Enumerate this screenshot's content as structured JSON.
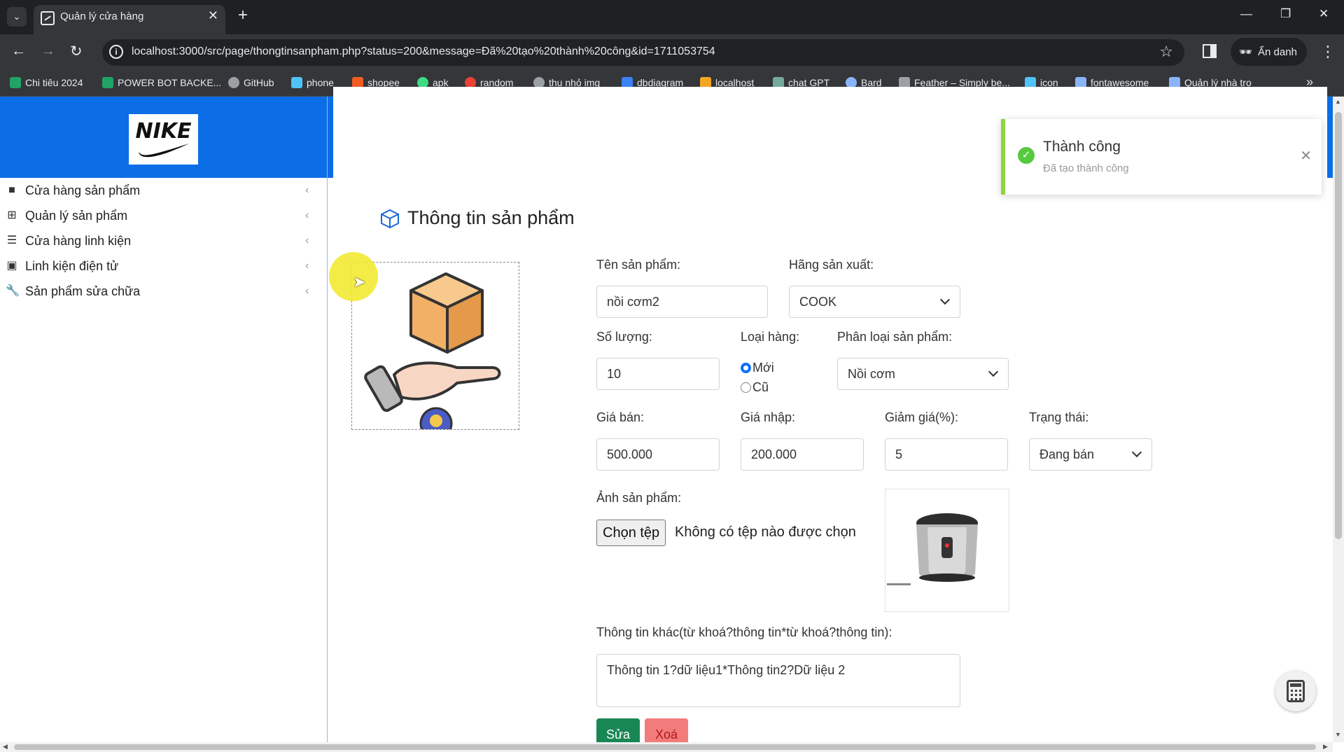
{
  "browser": {
    "tab_title": "Quản lý cửa hàng",
    "url": "localhost:3000/src/page/thongtinsanpham.php?status=200&message=Đã%20tạo%20thành%20công&id=1711053754",
    "profile_label": "Ẩn danh",
    "bookmarks": [
      {
        "label": "Chi tiêu 2024",
        "color": "#21a366"
      },
      {
        "label": "POWER BOT BACKE...",
        "color": "#21a366"
      },
      {
        "label": "GitHub",
        "color": "#9aa0a6"
      },
      {
        "label": "phone",
        "color": "#4fc3f7"
      },
      {
        "label": "shopee",
        "color": "#f05d23"
      },
      {
        "label": "apk",
        "color": "#3ddc84"
      },
      {
        "label": "random",
        "color": "#e94235"
      },
      {
        "label": "thu nhỏ img",
        "color": "#9aa0a6"
      },
      {
        "label": "dbdiagram",
        "color": "#3b82f6"
      },
      {
        "label": "localhost",
        "color": "#f5a623"
      },
      {
        "label": "chat GPT",
        "color": "#74aa9c"
      },
      {
        "label": "Bard",
        "color": "#8ab4f8"
      },
      {
        "label": "Feather – Simply be...",
        "color": "#9aa0a6"
      },
      {
        "label": "icon",
        "color": "#4fc3f7"
      },
      {
        "label": "fontawesome",
        "color": "#8ab4f8"
      },
      {
        "label": "Quản lý nhà trọ",
        "color": "#8ab4f8"
      }
    ]
  },
  "header": {
    "logo_text": "NIKE"
  },
  "sidebar": {
    "items": [
      {
        "label": "Cửa hàng sản phẩm",
        "icon": "bag-icon"
      },
      {
        "label": "Quản lý sản phẩm",
        "icon": "boxes-icon"
      },
      {
        "label": "Cửa hàng linh kiện",
        "icon": "server-icon"
      },
      {
        "label": "Linh kiện điện tử",
        "icon": "chip-icon"
      },
      {
        "label": "Sản phẩm sửa chữa",
        "icon": "wrench-icon"
      }
    ]
  },
  "form": {
    "title": "Thông tin sản phẩm",
    "name_label": "Tên sản phẩm:",
    "name_value": "nồi cơm2",
    "brand_label": "Hãng sản xuất:",
    "brand_value": "COOK",
    "qty_label": "Số lượng:",
    "qty_value": "10",
    "type_label": "Loại hàng:",
    "type_options": [
      "Mới",
      "Cũ"
    ],
    "type_selected": "Mới",
    "category_label": "Phân loại sản phẩm:",
    "category_value": "Nồi cơm",
    "price_label": "Giá bán:",
    "price_value": "500.000",
    "cost_label": "Giá nhập:",
    "cost_value": "200.000",
    "discount_label": "Giảm giá(%):",
    "discount_value": "5",
    "status_label": "Trạng thái:",
    "status_value": "Đang bán",
    "image_label": "Ảnh sản phẩm:",
    "file_button": "Chọn tệp",
    "file_status": "Không có tệp nào được chọn",
    "other_label": "Thông tin khác(từ khoá?thông tin*từ khoá?thông tin):",
    "other_value": "Thông tin 1?dữ liệu1*Thông tin2?Dữ liệu 2",
    "edit_button": "Sửa",
    "delete_button": "Xoá"
  },
  "toast": {
    "title": "Thành công",
    "message": "Đã tạo thành công",
    "accent": "#8ed63a"
  }
}
